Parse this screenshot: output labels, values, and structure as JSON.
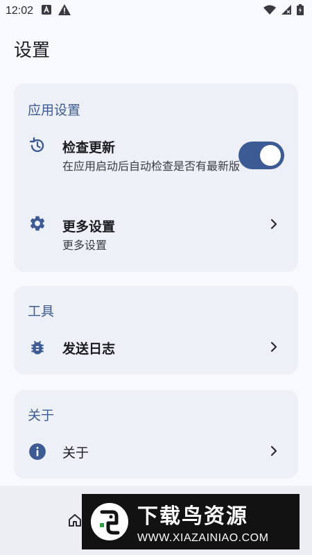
{
  "status_bar": {
    "time": "12:02",
    "icons": [
      "a-square-icon",
      "warning-icon",
      "wifi-icon",
      "signal-icon",
      "battery-icon"
    ]
  },
  "page": {
    "title": "设置"
  },
  "sections": {
    "app_settings": {
      "header": "应用设置",
      "check_update": {
        "title": "检查更新",
        "subtitle": "在应用启动后自动检查是否有最新版",
        "toggle_on": true,
        "icon": "history-icon"
      },
      "more_settings": {
        "title": "更多设置",
        "subtitle": "更多设置",
        "icon": "gear-icon"
      }
    },
    "tools": {
      "header": "工具",
      "send_log": {
        "title": "发送日志",
        "icon": "bug-icon"
      }
    },
    "about": {
      "header": "关于",
      "about_item": {
        "title": "关于",
        "icon": "info-icon"
      }
    }
  },
  "watermark": {
    "title": "下载鸟资源",
    "url": "WWW.XIAZAINIAO.COM"
  },
  "colors": {
    "accent": "#3c5a93",
    "card": "#eef0f7",
    "background": "#f8f9fd"
  }
}
